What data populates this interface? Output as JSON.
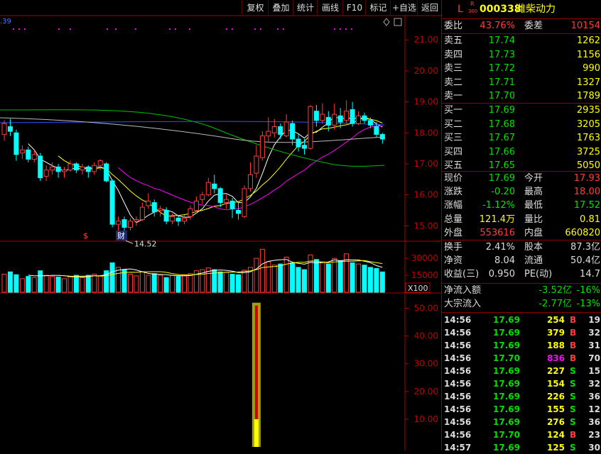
{
  "toolbar": {
    "buttons": [
      "复权",
      "叠加",
      "统计",
      "画线",
      "F10",
      "标记",
      "+自选",
      "返回"
    ]
  },
  "header": {
    "market_flag": "L",
    "tag_top": "R",
    "tag_bottom": "300",
    "code": "000338",
    "name": "潍柴动力"
  },
  "main_chart": {
    "corner_value": ".39",
    "y_ticks": [
      "21.00",
      "20.00",
      "19.00",
      "18.00",
      "17.00",
      "16.00",
      "15.00"
    ],
    "y_range": [
      14.55,
      21.6
    ],
    "low_label": "14.52",
    "marker_s": "$",
    "marker_cai": "财",
    "candles": [
      [
        17.95,
        18.3,
        18.4,
        17.75
      ],
      [
        18.2,
        18.05,
        18.45,
        17.9
      ],
      [
        18.0,
        17.3,
        18.1,
        17.1
      ],
      [
        17.35,
        17.45,
        17.6,
        17.15
      ],
      [
        17.45,
        17.15,
        17.55,
        17.05
      ],
      [
        17.15,
        17.3,
        17.45,
        17.05
      ],
      [
        17.25,
        16.55,
        17.35,
        16.45
      ],
      [
        16.6,
        16.8,
        16.95,
        16.45
      ],
      [
        16.8,
        16.9,
        17.05,
        16.65
      ],
      [
        16.9,
        16.75,
        17.0,
        16.55
      ],
      [
        16.75,
        16.8,
        16.9,
        16.55
      ],
      [
        16.8,
        17.0,
        17.1,
        16.75
      ],
      [
        17.0,
        16.8,
        17.05,
        16.7
      ],
      [
        16.8,
        16.9,
        17.0,
        16.65
      ],
      [
        16.9,
        16.75,
        16.95,
        16.55
      ],
      [
        16.75,
        16.95,
        17.05,
        16.65
      ],
      [
        16.95,
        17.1,
        17.15,
        16.8
      ],
      [
        17.0,
        16.45,
        17.05,
        16.4
      ],
      [
        16.45,
        15.05,
        16.5,
        14.95
      ],
      [
        15.05,
        15.15,
        15.3,
        14.75
      ],
      [
        15.2,
        14.95,
        15.3,
        14.52
      ],
      [
        14.95,
        15.15,
        15.25,
        14.85
      ],
      [
        15.15,
        15.2,
        15.3,
        15.0
      ],
      [
        15.2,
        15.6,
        15.75,
        15.15
      ],
      [
        15.65,
        15.8,
        16.05,
        15.55
      ],
      [
        15.75,
        15.45,
        15.85,
        15.3
      ],
      [
        15.5,
        15.55,
        15.65,
        15.3
      ],
      [
        15.5,
        15.15,
        15.6,
        15.05
      ],
      [
        15.15,
        15.3,
        15.4,
        15.05
      ],
      [
        15.25,
        15.15,
        15.35,
        15.0
      ],
      [
        15.15,
        15.25,
        15.35,
        15.05
      ],
      [
        15.3,
        15.55,
        15.65,
        15.2
      ],
      [
        15.5,
        15.8,
        15.95,
        15.45
      ],
      [
        15.85,
        16.0,
        16.1,
        15.7
      ],
      [
        16.0,
        16.4,
        16.55,
        15.95
      ],
      [
        16.35,
        16.2,
        16.65,
        16.05
      ],
      [
        16.2,
        15.75,
        16.25,
        15.6
      ],
      [
        15.75,
        15.85,
        16.0,
        15.55
      ],
      [
        15.8,
        15.55,
        15.9,
        15.25
      ],
      [
        15.5,
        15.4,
        15.8,
        15.2
      ],
      [
        15.3,
        16.2,
        16.3,
        15.25
      ],
      [
        16.2,
        16.65,
        17.05,
        16.1
      ],
      [
        16.7,
        17.25,
        17.6,
        16.55
      ],
      [
        17.2,
        17.9,
        18.05,
        17.1
      ],
      [
        17.9,
        18.05,
        18.5,
        17.7
      ],
      [
        18.0,
        18.2,
        18.45,
        17.85
      ],
      [
        18.2,
        17.95,
        18.3,
        17.8
      ],
      [
        17.9,
        18.35,
        18.6,
        17.85
      ],
      [
        18.3,
        17.8,
        18.4,
        17.6
      ],
      [
        17.8,
        17.55,
        17.95,
        17.4
      ],
      [
        17.6,
        17.5,
        17.8,
        17.3
      ],
      [
        17.5,
        18.85,
        18.9,
        17.45
      ],
      [
        18.7,
        18.4,
        18.9,
        18.2
      ],
      [
        18.4,
        18.6,
        18.95,
        18.3
      ],
      [
        18.5,
        18.25,
        18.7,
        18.05
      ],
      [
        18.25,
        18.6,
        18.95,
        18.1
      ],
      [
        18.55,
        18.35,
        18.8,
        18.15
      ],
      [
        18.4,
        18.7,
        19.05,
        18.3
      ],
      [
        18.75,
        18.3,
        19.0,
        18.2
      ],
      [
        18.3,
        18.55,
        18.7,
        18.25
      ],
      [
        18.55,
        18.4,
        18.65,
        18.3
      ],
      [
        18.4,
        18.25,
        18.5,
        18.15
      ],
      [
        18.2,
        17.95,
        18.35,
        17.85
      ],
      [
        17.95,
        17.8,
        18.0,
        17.65
      ]
    ]
  },
  "volume_chart": {
    "y_ticks": [
      "30000",
      "15000"
    ],
    "unit": "X100",
    "values": [
      16000,
      18000,
      15500,
      12000,
      14000,
      13000,
      19000,
      15000,
      14000,
      13500,
      12000,
      14000,
      15000,
      13000,
      15000,
      16000,
      14500,
      19000,
      26000,
      22000,
      20000,
      16000,
      14500,
      18000,
      15000,
      16500,
      15000,
      13000,
      15000,
      14000,
      15500,
      16500,
      19000,
      20000,
      21500,
      20000,
      18000,
      17500,
      16000,
      15500,
      19500,
      22000,
      30000,
      38000,
      27000,
      24000,
      25000,
      31000,
      26000,
      22000,
      20000,
      33000,
      29000,
      27000,
      25000,
      30000,
      28000,
      34000,
      26000,
      25000,
      24000,
      22000,
      21000,
      18000
    ],
    "ups": [
      1,
      0,
      0,
      1,
      0,
      1,
      0,
      1,
      1,
      0,
      1,
      1,
      0,
      1,
      0,
      1,
      1,
      0,
      0,
      1,
      0,
      1,
      1,
      1,
      1,
      0,
      1,
      0,
      1,
      0,
      1,
      1,
      1,
      1,
      1,
      0,
      0,
      1,
      0,
      0,
      1,
      1,
      1,
      1,
      1,
      1,
      0,
      1,
      0,
      0,
      0,
      1,
      0,
      1,
      0,
      1,
      0,
      1,
      0,
      1,
      0,
      0,
      0,
      0
    ]
  },
  "indicator_chart": {
    "y_ticks": [
      "50.00",
      "40.00",
      "30.00",
      "20.00",
      "10.00"
    ],
    "bar_value": 52,
    "bar_inner": 10
  },
  "quote": {
    "weibi_label": "委比",
    "weibi_value": "43.76%",
    "weicha_label": "委差",
    "weicha_value": "10154",
    "asks": [
      {
        "label": "卖五",
        "price": "17.74",
        "vol": "1262"
      },
      {
        "label": "卖四",
        "price": "17.73",
        "vol": "1156"
      },
      {
        "label": "卖三",
        "price": "17.72",
        "vol": "990"
      },
      {
        "label": "卖二",
        "price": "17.71",
        "vol": "1327"
      },
      {
        "label": "卖一",
        "price": "17.70",
        "vol": "1789"
      }
    ],
    "bids": [
      {
        "label": "买一",
        "price": "17.69",
        "vol": "2935"
      },
      {
        "label": "买二",
        "price": "17.68",
        "vol": "3205"
      },
      {
        "label": "买三",
        "price": "17.67",
        "vol": "1763"
      },
      {
        "label": "买四",
        "price": "17.66",
        "vol": "3725"
      },
      {
        "label": "买五",
        "price": "17.65",
        "vol": "5050"
      }
    ],
    "stats": [
      {
        "l1": "现价",
        "v1": "17.69",
        "c1": "g",
        "l2": "今开",
        "v2": "17.93",
        "c2": "r"
      },
      {
        "l1": "涨跌",
        "v1": "-0.20",
        "c1": "g",
        "l2": "最高",
        "v2": "18.00",
        "c2": "r"
      },
      {
        "l1": "涨幅",
        "v1": "-1.12%",
        "c1": "g",
        "l2": "最低",
        "v2": "17.52",
        "c2": "g"
      },
      {
        "l1": "总量",
        "v1": "121.4万",
        "c1": "y",
        "l2": "量比",
        "v2": "0.81",
        "c2": "y"
      },
      {
        "l1": "外盘",
        "v1": "553616",
        "c1": "r",
        "l2": "内盘",
        "v2": "660820",
        "c2": "y"
      }
    ],
    "stats2": [
      {
        "l1": "换手",
        "v1": "2.41%",
        "l2": "股本",
        "v2": "87.3亿"
      },
      {
        "l1": "净资",
        "v1": "8.04",
        "l2": "流通",
        "v2": "50.4亿"
      },
      {
        "l1": "收益(三)",
        "v1": "0.950",
        "l2": "PE(动)",
        "v2": "14.7"
      }
    ],
    "flows": [
      {
        "label": "净流入额",
        "value": "-3.52亿",
        "pct": "-16%"
      },
      {
        "label": "大宗流入",
        "value": "-2.77亿",
        "pct": "-13%"
      }
    ]
  },
  "ticks": [
    {
      "time": "14:56",
      "price": "17.69",
      "vol": "254",
      "side": "B",
      "n": "19",
      "pc": "g",
      "vc": "y"
    },
    {
      "time": "14:56",
      "price": "17.69",
      "vol": "379",
      "side": "B",
      "n": "32",
      "pc": "g",
      "vc": "y"
    },
    {
      "time": "14:56",
      "price": "17.69",
      "vol": "188",
      "side": "B",
      "n": "31",
      "pc": "g",
      "vc": "y"
    },
    {
      "time": "14:56",
      "price": "17.70",
      "vol": "836",
      "side": "B",
      "n": "70",
      "pc": "g",
      "vc": "m"
    },
    {
      "time": "14:56",
      "price": "17.69",
      "vol": "227",
      "side": "S",
      "n": "15",
      "pc": "g",
      "vc": "y"
    },
    {
      "time": "14:56",
      "price": "17.69",
      "vol": "154",
      "side": "S",
      "n": "32",
      "pc": "g",
      "vc": "y"
    },
    {
      "time": "14:56",
      "price": "17.69",
      "vol": "226",
      "side": "S",
      "n": "36",
      "pc": "g",
      "vc": "y"
    },
    {
      "time": "14:56",
      "price": "17.69",
      "vol": "155",
      "side": "S",
      "n": "12",
      "pc": "g",
      "vc": "y"
    },
    {
      "time": "14:56",
      "price": "17.69",
      "vol": "276",
      "side": "S",
      "n": "36",
      "pc": "g",
      "vc": "y"
    },
    {
      "time": "14:56",
      "price": "17.70",
      "vol": "124",
      "side": "B",
      "n": "23",
      "pc": "g",
      "vc": "y"
    },
    {
      "time": "14:57",
      "price": "17.69",
      "vol": "125",
      "side": "S",
      "n": "30",
      "pc": "g",
      "vc": "y"
    }
  ]
}
